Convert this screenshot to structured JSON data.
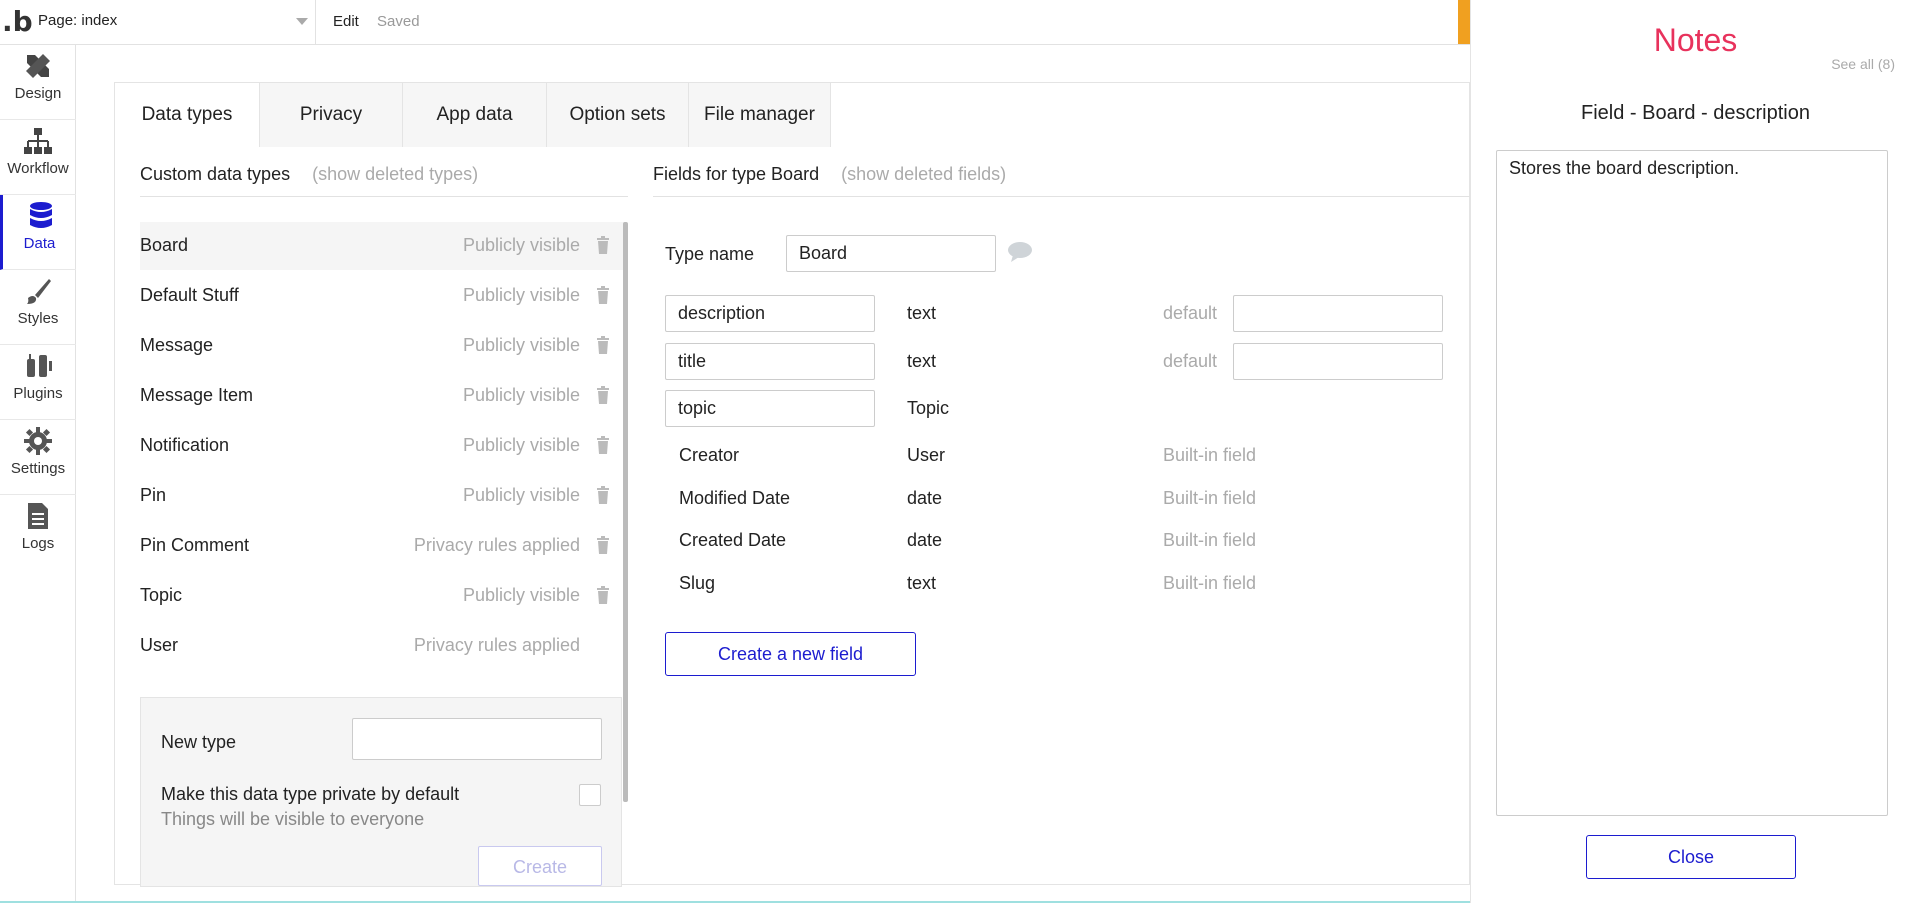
{
  "topbar": {
    "page_label": "Page: index",
    "edit_label": "Edit",
    "status": "Saved"
  },
  "sidebar": {
    "items": [
      {
        "label": "Design",
        "icon": "design-icon"
      },
      {
        "label": "Workflow",
        "icon": "workflow-icon"
      },
      {
        "label": "Data",
        "icon": "database-icon"
      },
      {
        "label": "Styles",
        "icon": "brush-icon"
      },
      {
        "label": "Plugins",
        "icon": "plug-icon"
      },
      {
        "label": "Settings",
        "icon": "gear-icon"
      },
      {
        "label": "Logs",
        "icon": "document-icon"
      }
    ],
    "active": "Data"
  },
  "tabs": [
    "Data types",
    "Privacy",
    "App data",
    "Option sets",
    "File manager"
  ],
  "custom_types": {
    "heading": "Custom data types",
    "show_deleted": "(show deleted types)",
    "items": [
      {
        "name": "Board",
        "visibility": "Publicly visible"
      },
      {
        "name": "Default Stuff",
        "visibility": "Publicly visible"
      },
      {
        "name": "Message",
        "visibility": "Publicly visible"
      },
      {
        "name": "Message Item",
        "visibility": "Publicly visible"
      },
      {
        "name": "Notification",
        "visibility": "Publicly visible"
      },
      {
        "name": "Pin",
        "visibility": "Publicly visible"
      },
      {
        "name": "Pin Comment",
        "visibility": "Privacy rules applied"
      },
      {
        "name": "Topic",
        "visibility": "Publicly visible"
      },
      {
        "name": "User",
        "visibility": "Privacy rules applied"
      }
    ]
  },
  "new_type": {
    "label": "New type",
    "input_value": "",
    "private_label": "Make this data type private by default",
    "private_hint": "Things will be visible to everyone",
    "create_label": "Create"
  },
  "fields": {
    "heading": "Fields for type Board",
    "show_deleted": "(show deleted fields)",
    "type_name_label": "Type name",
    "type_name_value": "Board",
    "custom": [
      {
        "name": "description",
        "type": "text",
        "default_label": "default",
        "default_value": ""
      },
      {
        "name": "title",
        "type": "text",
        "default_label": "default",
        "default_value": ""
      },
      {
        "name": "topic",
        "type": "Topic"
      }
    ],
    "builtin": [
      {
        "name": "Creator",
        "type": "User",
        "note": "Built-in field"
      },
      {
        "name": "Modified Date",
        "type": "date",
        "note": "Built-in field"
      },
      {
        "name": "Created Date",
        "type": "date",
        "note": "Built-in field"
      },
      {
        "name": "Slug",
        "type": "text",
        "note": "Built-in field"
      }
    ],
    "create_button": "Create a new field"
  },
  "notes": {
    "title": "Notes",
    "see_all": "See all (8)",
    "subtitle": "Field - Board - description",
    "content": "Stores the board description.",
    "close_label": "Close"
  },
  "colors": {
    "accent": "#1c1ccf",
    "notes_title": "#e8325c",
    "muted": "#aaaaaa"
  }
}
